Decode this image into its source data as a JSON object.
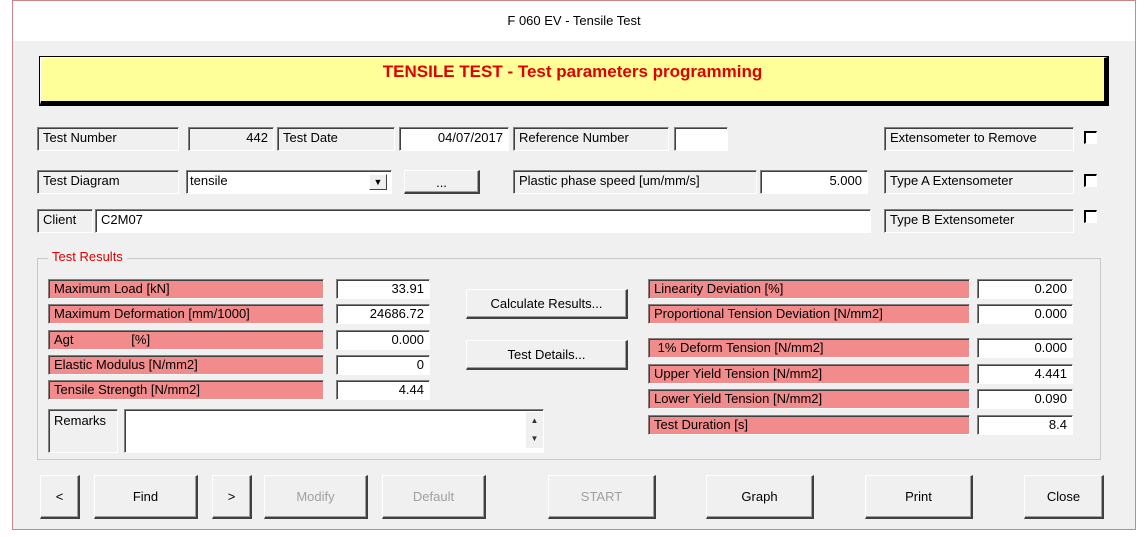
{
  "window": {
    "title": "F 060 EV - Tensile Test"
  },
  "banner": {
    "text": "TENSILE TEST - Test parameters programming"
  },
  "header": {
    "test_number_label": "Test Number",
    "test_number_value": "442",
    "test_date_label": "Test Date",
    "test_date_value": "04/07/2017",
    "reference_number_label": "Reference Number",
    "reference_number_value": "",
    "ext_remove_label": "Extensometer to Remove",
    "test_diagram_label": "Test Diagram",
    "test_diagram_value": "tensile",
    "browse_label": "...",
    "plastic_speed_label": "Plastic phase speed [um/mm/s]",
    "plastic_speed_value": "5.000",
    "ext_a_label": "Type A Extensometer",
    "client_label": "Client",
    "client_value": "C2M07",
    "ext_b_label": "Type B Extensometer"
  },
  "results": {
    "title": "Test Results",
    "left": [
      {
        "label": "Maximum Load  [kN]",
        "value": "33.91"
      },
      {
        "label": "Maximum Deformation [mm/1000]",
        "value": "24686.72"
      },
      {
        "label": "Agt                [%]",
        "value": "0.000"
      },
      {
        "label": "Elastic Modulus [N/mm2]",
        "value": "0"
      },
      {
        "label": "Tensile Strength  [N/mm2]",
        "value": "4.44"
      }
    ],
    "right": [
      {
        "label": "Linearity Deviation [%]",
        "value": "0.200"
      },
      {
        "label": "Proportional Tension Deviation [N/mm2]",
        "value": "0.000"
      },
      {
        "label": " 1% Deform Tension [N/mm2]",
        "value": "0.000"
      },
      {
        "label": "Upper Yield Tension [N/mm2]",
        "value": "4.441"
      },
      {
        "label": "Lower Yield Tension [N/mm2]",
        "value": "0.090"
      },
      {
        "label": "Test Duration [s]",
        "value": "8.4"
      }
    ],
    "calculate_label": "Calculate Results...",
    "details_label": "Test Details...",
    "remarks_label": "Remarks",
    "remarks_value": ""
  },
  "toolbar": {
    "prev_label": "<",
    "find_label": "Find",
    "next_label": ">",
    "modify_label": "Modify",
    "default_label": "Default",
    "start_label": "START",
    "graph_label": "Graph",
    "print_label": "Print",
    "close_label": "Close"
  },
  "colors": {
    "banner_bg": "#ffff99",
    "banner_text": "#e00000",
    "result_label_bg": "#f28b8b",
    "group_title": "#e00000"
  }
}
